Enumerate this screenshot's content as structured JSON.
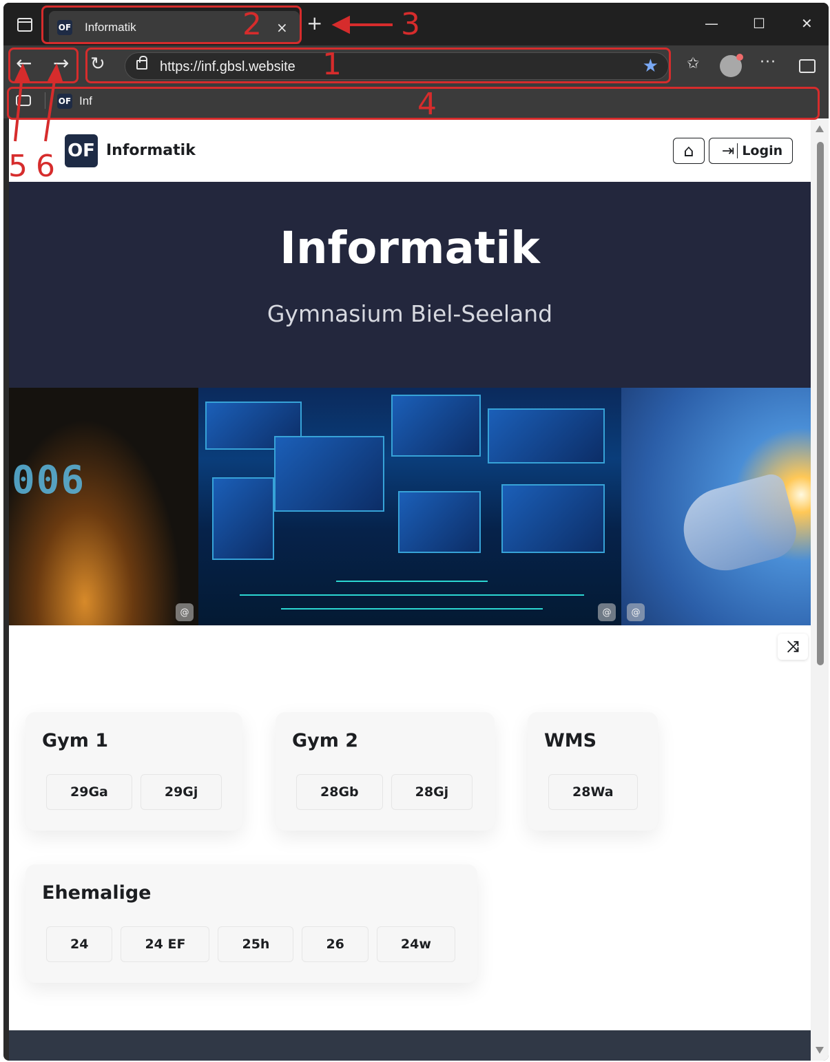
{
  "browser": {
    "tab": {
      "favicon_text": "OF",
      "title": "Informatik",
      "close_glyph": "×"
    },
    "new_tab_glyph": "+",
    "window_controls": {
      "minimize": "—",
      "maximize": "☐",
      "close": "✕"
    },
    "nav": {
      "back_glyph": "←",
      "forward_glyph": "→",
      "reload_glyph": "↻"
    },
    "address_bar": {
      "url": "https://inf.gbsl.website",
      "favorite_glyph": "★"
    },
    "toolbar_icons": [
      "lock-icon",
      "star-icon",
      "favorites-icon",
      "profile-avatar",
      "more-icon",
      "split-screen-icon"
    ],
    "favorites_glyph": "✩",
    "more_glyph": "···",
    "bookmarks": [
      {
        "favicon_text": "OF",
        "label": "Inf"
      }
    ]
  },
  "site": {
    "logo_text": "OF",
    "name": "Informatik",
    "login_label": "Login",
    "login_glyph": "⇥",
    "home_glyph": "⌂",
    "hero": {
      "title": "Informatik",
      "subtitle": "Gymnasium Biel-Seeland"
    },
    "gallery": {
      "digits": "006",
      "badge_glyph": "@"
    },
    "shuffle_glyph": "⤨",
    "groups": [
      {
        "title": "Gym 1",
        "classes": [
          "29Ga",
          "29Gj"
        ]
      },
      {
        "title": "Gym 2",
        "classes": [
          "28Gb",
          "28Gj"
        ]
      },
      {
        "title": "WMS",
        "classes": [
          "28Wa"
        ]
      },
      {
        "title": "Ehemalige",
        "classes": [
          "24",
          "24 EF",
          "25h",
          "26",
          "24w"
        ]
      }
    ]
  },
  "annotations": [
    "1",
    "2",
    "3",
    "4",
    "5",
    "6"
  ],
  "colors": {
    "annotation": "#d62c2c",
    "hero_bg": "#23273d",
    "brand": "#1e2b45",
    "footer": "#303846"
  }
}
